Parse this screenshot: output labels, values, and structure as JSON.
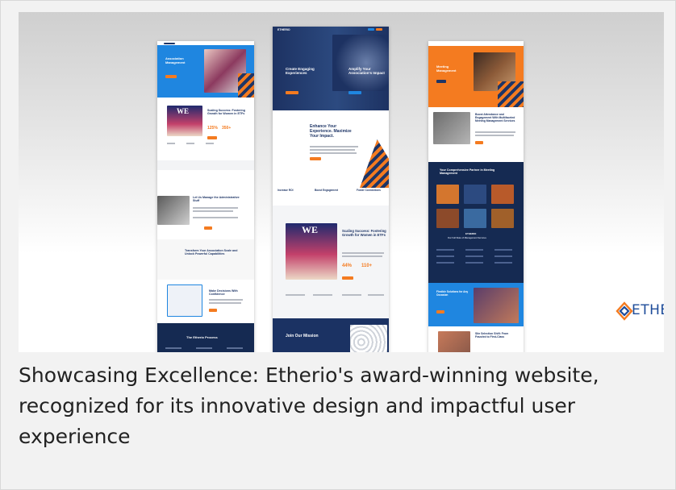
{
  "brand": {
    "name": "ETHERIO",
    "accent": "#f47b20",
    "navy": "#1e3566",
    "blue": "#1f86e0"
  },
  "caption": "Showcasing Excellence: Etherio's award-winning website, recognized for its innovative design and impactful user experience",
  "screens": {
    "left": {
      "hero_title": "Association Management",
      "badge_title": "WE",
      "feature_title": "Scaling Success: Fostering Growth for Women in ETFs",
      "stat_a": "125%",
      "stat_b": "350+",
      "section2_title": "Let Us Manage the Administrative Stuff",
      "section3_title": "Transform Your Association Scale and Unlock Powerful Capabilities",
      "section4_title": "Make Decisions With Confidence",
      "process_title": "The Etherio Process"
    },
    "center": {
      "nav_logo": "ETHERIO",
      "hero_left_title": "Create Engaging Experiences",
      "hero_right_title": "Amplify Your Association's Impact",
      "headline": "Enhance Your Experience. Maximize Your Impact.",
      "feature_1": "Increase ROI",
      "feature_2": "Boost Engagement",
      "feature_3": "Foster Connections",
      "badge_title": "WE",
      "case_title": "Scaling Success: Fostering Growth for Women in ETFs",
      "stat_a": "44%",
      "stat_b": "110+",
      "mission_title": "Join Our Mission"
    },
    "right": {
      "hero_title": "Meeting Management",
      "section_title": "Boost Attendance and Engagement With Multifaceted Meeting Management Services",
      "partner_title": "Your Comprehensive Partner in Meeting Management",
      "grid_title": "ETHERIO",
      "services_title": "Our Full Slate of Management Services",
      "cta_title": "Flexible Solutions for Any Occasion",
      "site_title": "Site Selection Shift: From Frazzled to First-Class"
    }
  },
  "icons": {
    "logo": "etherio-logo-icon"
  }
}
